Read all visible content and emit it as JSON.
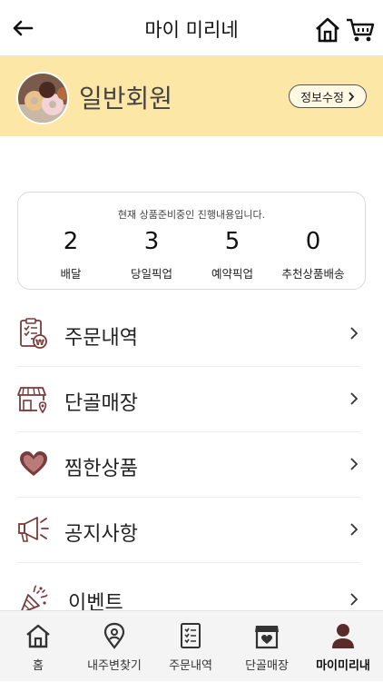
{
  "header": {
    "title": "마이 미리네"
  },
  "profile": {
    "member_level": "일반회원",
    "edit_label": "정보수정"
  },
  "status": {
    "caption": "현재 상품준비중인 진행내용입니다.",
    "items": [
      {
        "count": "2",
        "label": "배달"
      },
      {
        "count": "3",
        "label": "당일픽업"
      },
      {
        "count": "5",
        "label": "예약픽업"
      },
      {
        "count": "0",
        "label": "추천상품배송"
      }
    ]
  },
  "menu": {
    "items": [
      {
        "label": "주문내역",
        "icon": "order-history-icon"
      },
      {
        "label": "단골매장",
        "icon": "favorite-store-icon"
      },
      {
        "label": "찜한상품",
        "icon": "heart-icon"
      },
      {
        "label": "공지사항",
        "icon": "megaphone-icon"
      },
      {
        "label": "이벤트",
        "icon": "party-popper-icon"
      }
    ]
  },
  "tabbar": {
    "items": [
      {
        "label": "홈",
        "icon": "home-icon"
      },
      {
        "label": "내주변찾기",
        "icon": "location-pin-icon"
      },
      {
        "label": "주문내역",
        "icon": "receipt-icon"
      },
      {
        "label": "단골매장",
        "icon": "store-heart-icon"
      },
      {
        "label": "마이미리내",
        "icon": "person-icon"
      }
    ],
    "active": "마이미리내"
  },
  "colors": {
    "accent": "#5a2b2b",
    "profile_bg": "#fde7a6",
    "icon_brown": "#7a3b3b"
  }
}
